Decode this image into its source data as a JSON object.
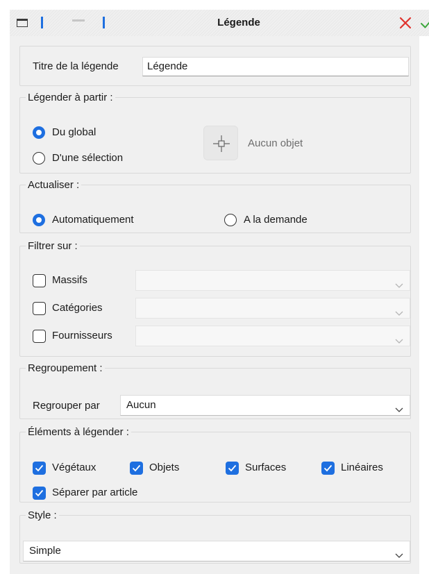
{
  "window": {
    "title": "Légende"
  },
  "title_section": {
    "label": "Titre de la légende",
    "value": "Légende"
  },
  "source": {
    "legend": "Légender à partir :",
    "options": [
      {
        "label": "Du global",
        "checked": true
      },
      {
        "label": "D'une sélection",
        "checked": false
      }
    ],
    "pick_status": "Aucun objet"
  },
  "refresh": {
    "legend": "Actualiser :",
    "options": [
      {
        "label": "Automatiquement",
        "checked": true
      },
      {
        "label": "A la demande",
        "checked": false
      }
    ]
  },
  "filter": {
    "legend": "Filtrer sur :",
    "items": [
      {
        "label": "Massifs",
        "checked": false,
        "value": ""
      },
      {
        "label": "Catégories",
        "checked": false,
        "value": ""
      },
      {
        "label": "Fournisseurs",
        "checked": false,
        "value": ""
      }
    ]
  },
  "grouping": {
    "legend": "Regroupement :",
    "label": "Regrouper par",
    "value": "Aucun"
  },
  "elements": {
    "legend": "Éléments à légender :",
    "items": [
      {
        "label": "Végétaux",
        "checked": true
      },
      {
        "label": "Objets",
        "checked": true
      },
      {
        "label": "Surfaces",
        "checked": true
      },
      {
        "label": "Linéaires",
        "checked": true
      },
      {
        "label": "Séparer par article",
        "checked": true
      }
    ]
  },
  "style": {
    "legend": "Style :",
    "value": "Simple"
  },
  "colors": {
    "accent": "#1e6fe0",
    "close": "#e0322d",
    "ok": "#3ba63b"
  },
  "icons": {
    "window": "window-icon",
    "close": "close-icon",
    "ok": "checkmark-icon",
    "pick": "crosshair-icon",
    "dropdown": "chevron-down-icon"
  }
}
